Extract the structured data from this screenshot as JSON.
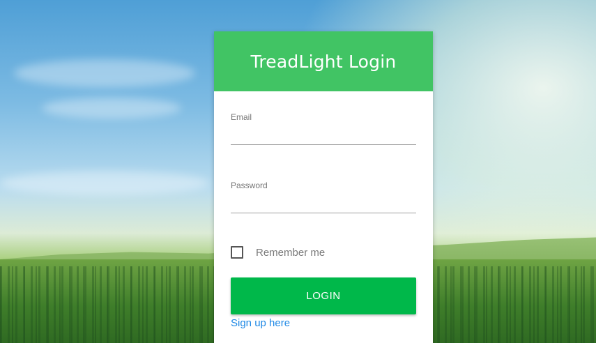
{
  "login": {
    "title": "TreadLight Login",
    "email_label": "Email",
    "email_value": "",
    "password_label": "Password",
    "password_value": "",
    "remember_label": "Remember me",
    "remember_checked": false,
    "button_label": "LOGIN",
    "signup_link": "Sign up here"
  },
  "colors": {
    "header_green": "#41c464",
    "button_green": "#00b84a",
    "link_blue": "#1e88e5"
  },
  "background": {
    "description_icon": "landscape-photo"
  }
}
